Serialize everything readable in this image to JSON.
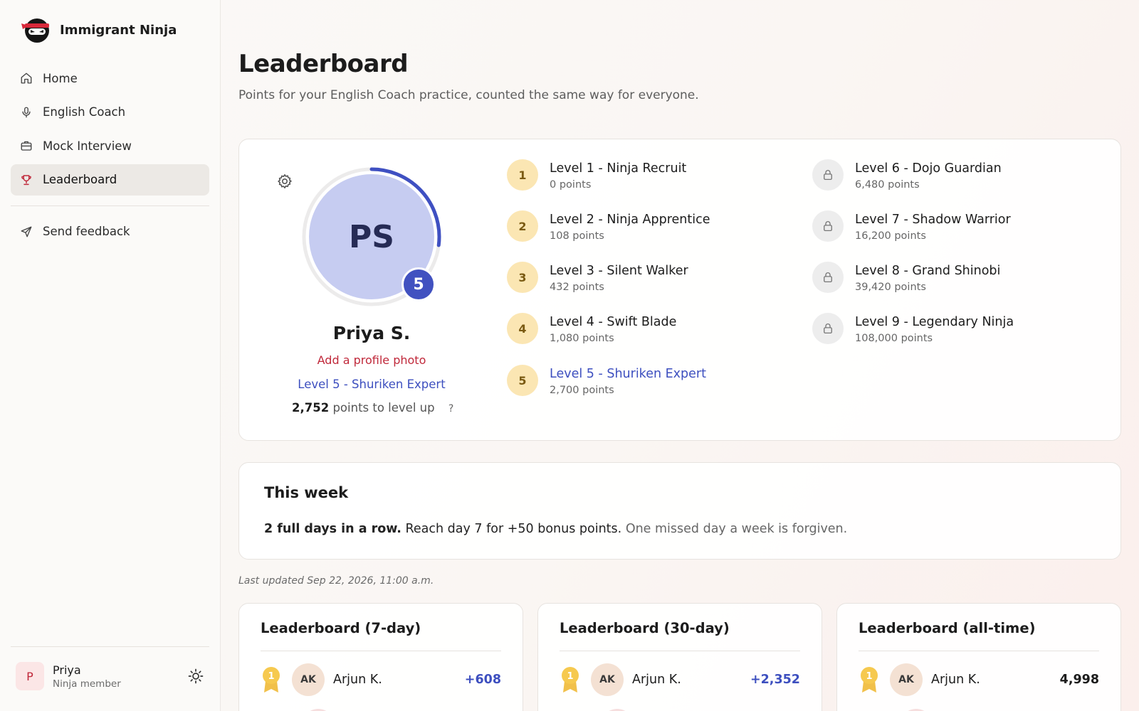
{
  "app": {
    "name": "Immigrant Ninja"
  },
  "sidebar": {
    "items": [
      {
        "label": "Home",
        "icon": "home-icon"
      },
      {
        "label": "English Coach",
        "icon": "microphone-icon"
      },
      {
        "label": "Mock Interview",
        "icon": "briefcase-icon"
      },
      {
        "label": "Leaderboard",
        "icon": "trophy-icon",
        "active": true
      }
    ],
    "feedback": {
      "label": "Send feedback",
      "icon": "send-icon"
    },
    "user": {
      "initial": "P",
      "name": "Priya",
      "role": "Ninja member"
    }
  },
  "page": {
    "title": "Leaderboard",
    "subtitle": "Points for your English Coach practice, counted the same way for everyone."
  },
  "profile": {
    "initials": "PS",
    "level_number": "5",
    "name": "Priya S.",
    "add_photo": "Add a profile photo",
    "level_label": "Level 5 - Shuriken Expert",
    "points_to_level_up": "2,752",
    "points_to_level_up_text": "points to level up",
    "help": "?",
    "progress_fraction": 0.27
  },
  "levels": [
    {
      "badge": "1",
      "title": "Level 1 - Ninja Recruit",
      "points": "0 points",
      "locked": false,
      "current": false
    },
    {
      "badge": "2",
      "title": "Level 2 - Ninja Apprentice",
      "points": "108 points",
      "locked": false,
      "current": false
    },
    {
      "badge": "3",
      "title": "Level 3 - Silent Walker",
      "points": "432 points",
      "locked": false,
      "current": false
    },
    {
      "badge": "4",
      "title": "Level 4 - Swift Blade",
      "points": "1,080 points",
      "locked": false,
      "current": false
    },
    {
      "badge": "5",
      "title": "Level 5 - Shuriken Expert",
      "points": "2,700 points",
      "locked": false,
      "current": true
    },
    {
      "badge": "",
      "title": "Level 6 - Dojo Guardian",
      "points": "6,480 points",
      "locked": true,
      "current": false
    },
    {
      "badge": "",
      "title": "Level 7 - Shadow Warrior",
      "points": "16,200 points",
      "locked": true,
      "current": false
    },
    {
      "badge": "",
      "title": "Level 8 - Grand Shinobi",
      "points": "39,420 points",
      "locked": true,
      "current": false
    },
    {
      "badge": "",
      "title": "Level 9 - Legendary Ninja",
      "points": "108,000 points",
      "locked": true,
      "current": false
    }
  ],
  "week": {
    "title": "This week",
    "streak_bold": "2 full days in a row.",
    "streak_text": "Reach day 7 for +50 bonus points.",
    "streak_muted": "One missed day a week is forgiven."
  },
  "last_updated": "Last updated Sep 22, 2026, 11:00 a.m.",
  "leaderboards": [
    {
      "title": "Leaderboard (7-day)",
      "rank": "1",
      "avatar": "AK",
      "name": "Arjun K.",
      "score": "+608"
    },
    {
      "title": "Leaderboard (30-day)",
      "rank": "1",
      "avatar": "AK",
      "name": "Arjun K.",
      "score": "+2,352"
    },
    {
      "title": "Leaderboard (all-time)",
      "rank": "1",
      "avatar": "AK",
      "name": "Arjun K.",
      "score": "4,998"
    }
  ],
  "colors": {
    "accent": "#3d4fbf",
    "brand_red": "#c0283a",
    "level_gold": "#fbe6b3"
  }
}
